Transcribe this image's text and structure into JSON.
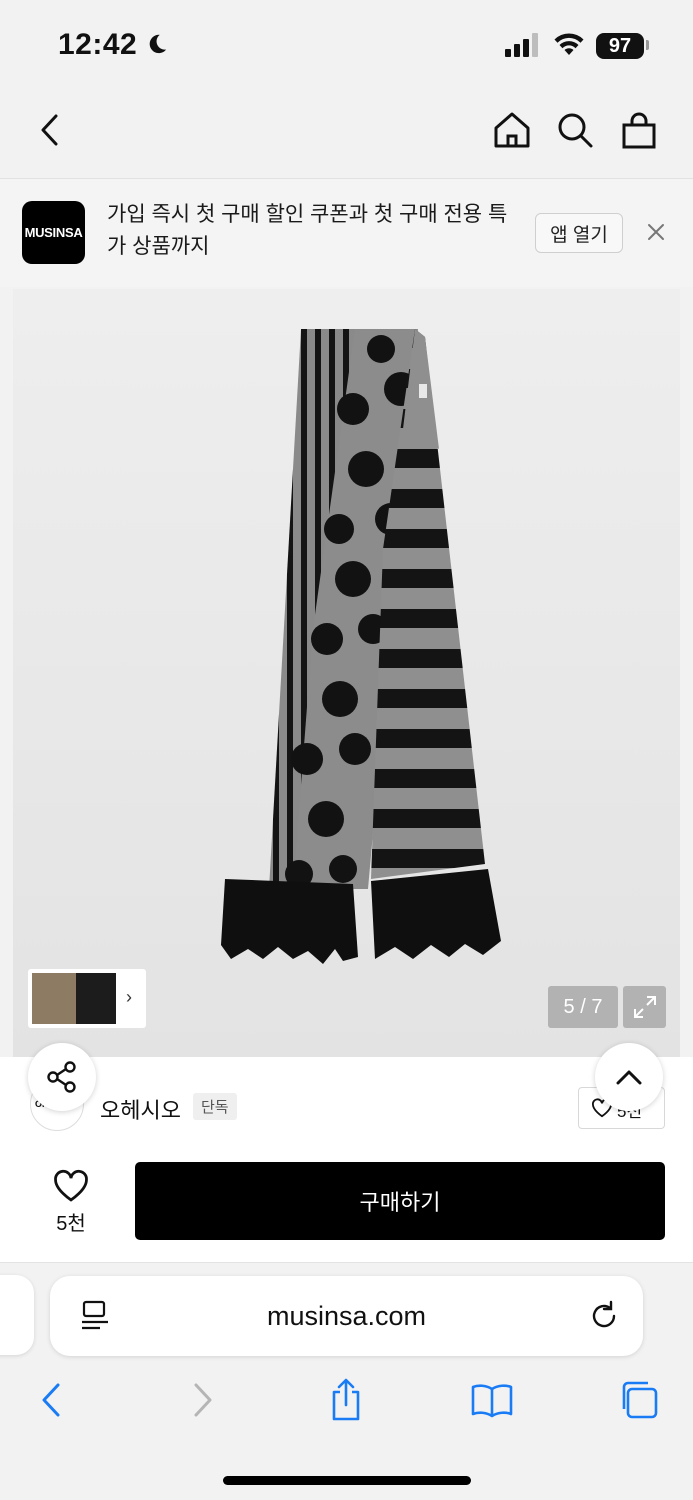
{
  "status_bar": {
    "time": "12:42",
    "battery": "97"
  },
  "nav": {
    "back_icon": "chevron-left-icon",
    "home_icon": "home-icon",
    "search_icon": "search-icon",
    "cart_icon": "shopping-bag-icon"
  },
  "promo": {
    "logo_text": "MUSINSA",
    "text": "가입 즉시 첫 구매 할인 쿠폰과 첫 구매 전용 특가 상품까지",
    "open_app_label": "앱 열기",
    "close_icon": "close-icon"
  },
  "gallery": {
    "counter": "5 / 7",
    "current_index": 5,
    "total": 7,
    "expand_icon": "expand-icon"
  },
  "brand": {
    "avatar_text": "OH",
    "name": "오헤시오",
    "badge": "단독",
    "like_count": "5천"
  },
  "buy_bar": {
    "wish_count": "5천",
    "buy_label": "구매하기"
  },
  "safari": {
    "url": "musinsa.com",
    "accent_color": "#1a7cf5"
  },
  "colors": {
    "brand_black": "#000000",
    "background": "#f2f2f2"
  }
}
